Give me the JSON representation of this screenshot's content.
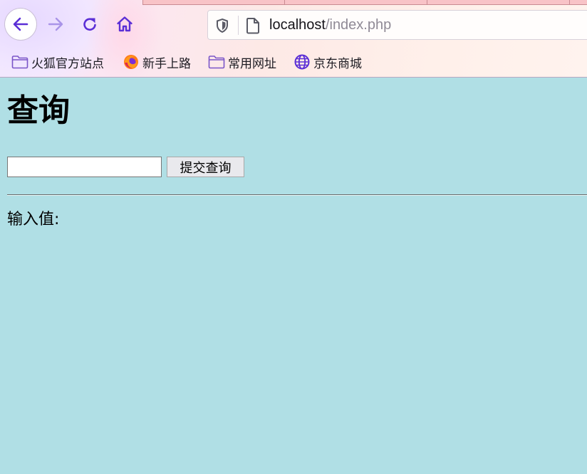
{
  "browser": {
    "url_host": "localhost",
    "url_path": "/index.php",
    "bookmarks": [
      {
        "label": "火狐官方站点",
        "icon": "folder-icon"
      },
      {
        "label": "新手上路",
        "icon": "firefox-icon"
      },
      {
        "label": "常用网址",
        "icon": "folder-icon"
      },
      {
        "label": "京东商城",
        "icon": "globe-icon"
      }
    ],
    "accent_color": "#5b2fd6"
  },
  "page": {
    "background_color": "#b0dfe5",
    "title": "查询",
    "search_input_value": "",
    "submit_label": "提交查询",
    "result_label": "输入值:"
  }
}
